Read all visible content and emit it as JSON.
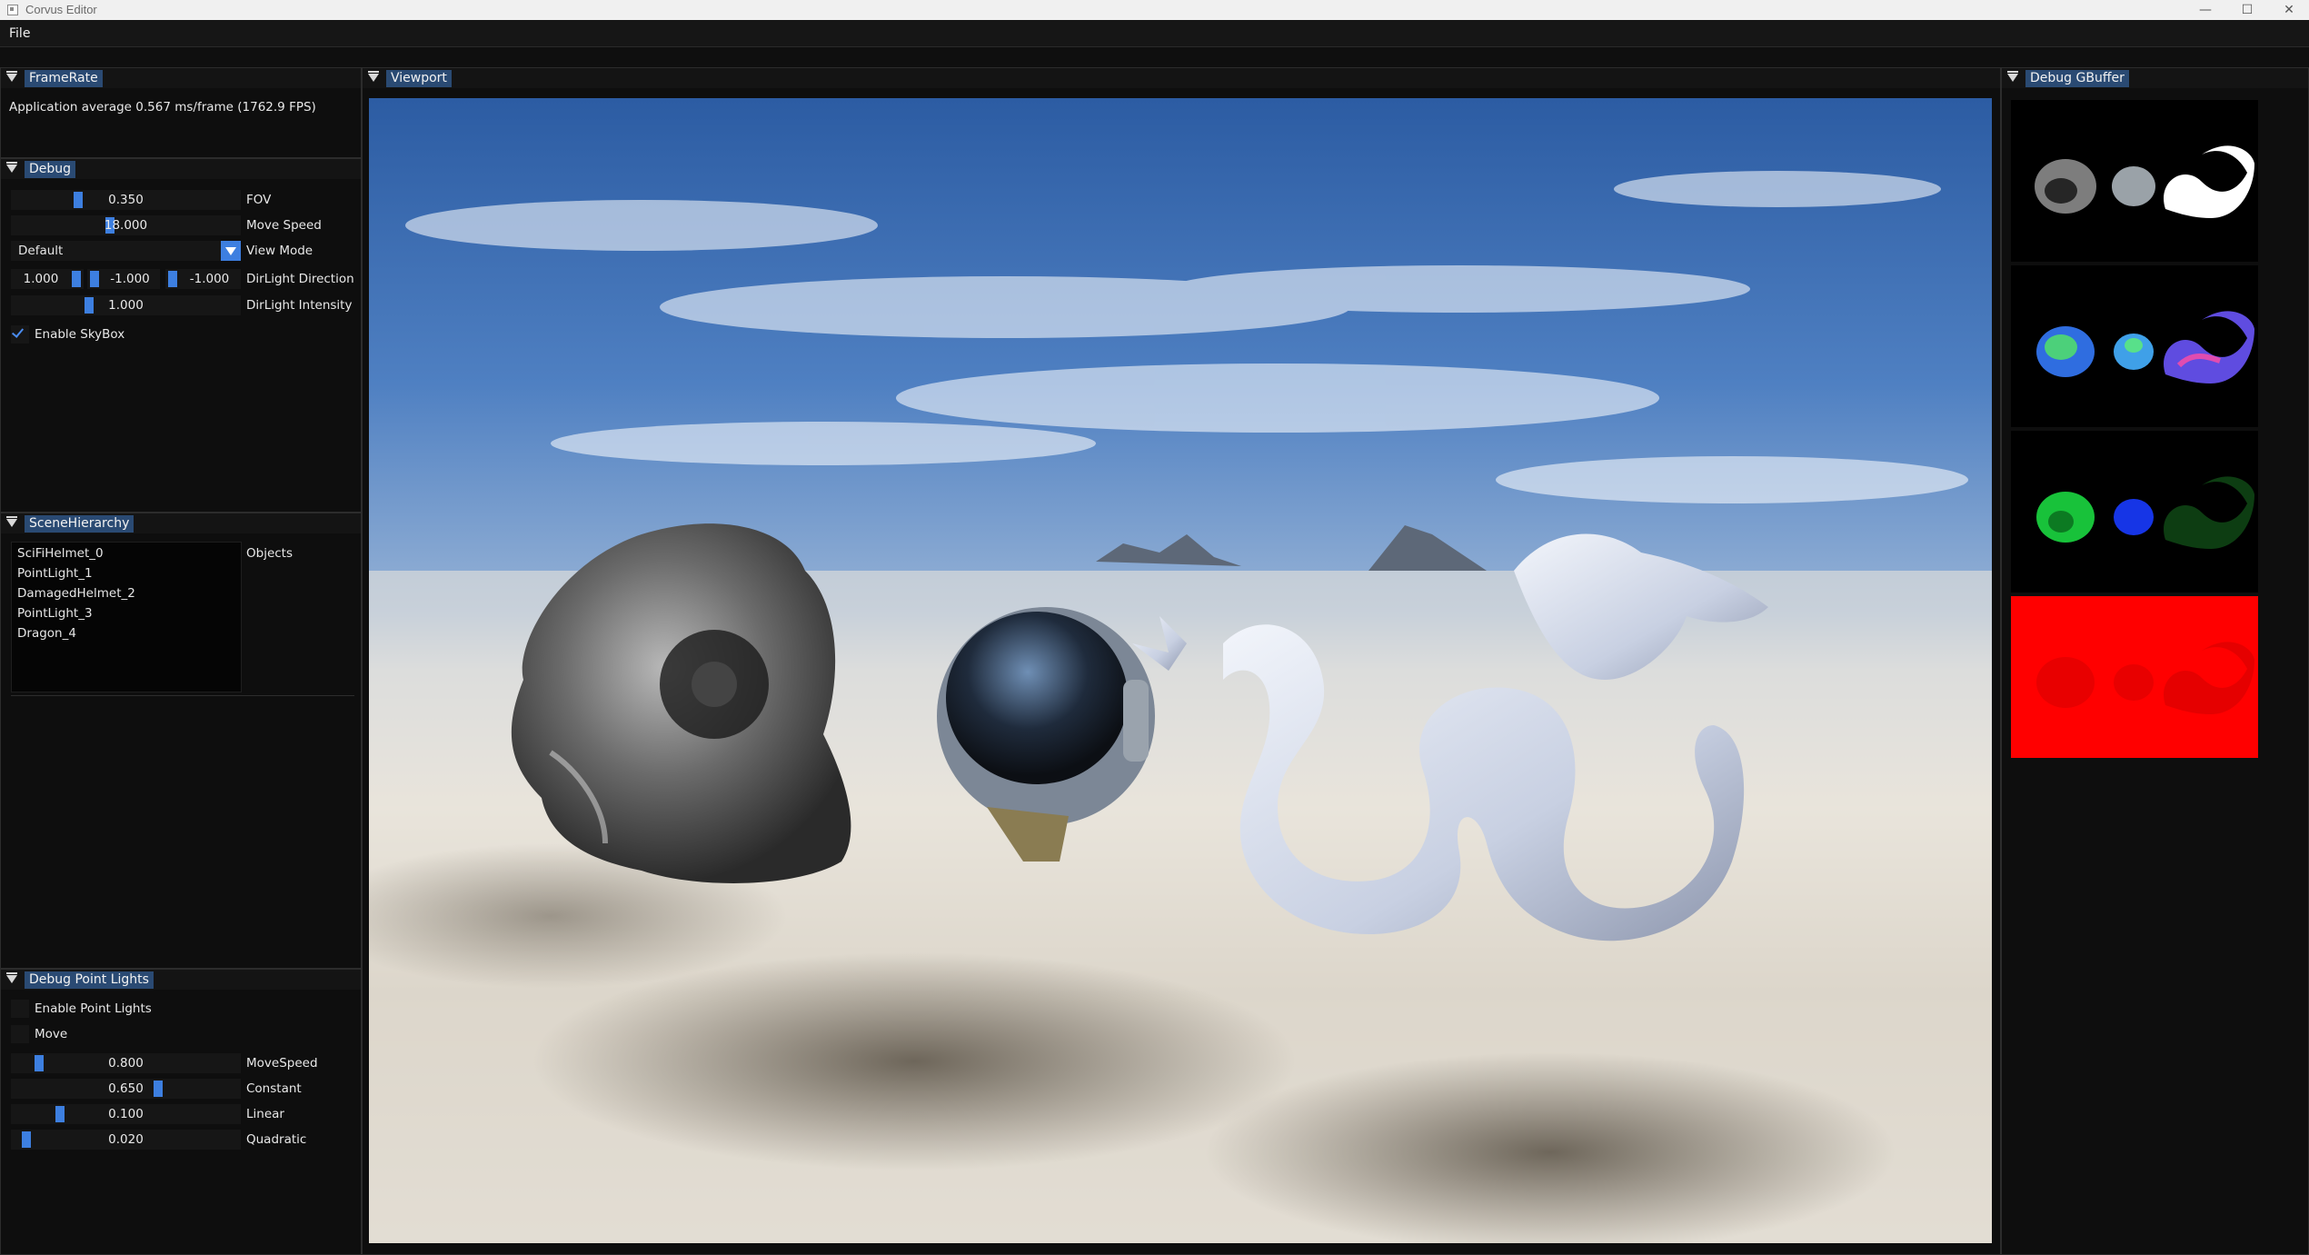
{
  "window": {
    "title": "Corvus Editor",
    "minimize_icon": "minimize-icon",
    "maximize_icon": "maximize-icon",
    "close_icon": "close-icon"
  },
  "menu": {
    "items": [
      "File"
    ]
  },
  "framerate": {
    "tab": "FrameRate",
    "text": "Application average 0.567 ms/frame (1762.9 FPS)"
  },
  "debug": {
    "tab": "Debug",
    "fov": {
      "label": "FOV",
      "value": "0.350"
    },
    "move_speed": {
      "label": "Move Speed",
      "value": "18.000"
    },
    "view_mode": {
      "label": "View Mode",
      "value": "Default"
    },
    "dir_light_direction": {
      "label": "DirLight Direction",
      "x": "1.000",
      "y": "-1.000",
      "z": "-1.000"
    },
    "dir_light_intensity": {
      "label": "DirLight Intensity",
      "value": "1.000"
    },
    "enable_skybox": {
      "label": "Enable SkyBox",
      "checked": true
    }
  },
  "scene_hierarchy": {
    "tab": "SceneHierarchy",
    "objects_label": "Objects",
    "objects": [
      "SciFiHelmet_0",
      "PointLight_1",
      "DamagedHelmet_2",
      "PointLight_3",
      "Dragon_4"
    ]
  },
  "debug_point_lights": {
    "tab": "Debug Point Lights",
    "enable": {
      "label": "Enable Point Lights",
      "checked": false
    },
    "move": {
      "label": "Move",
      "checked": false
    },
    "move_speed": {
      "label": "MoveSpeed",
      "value": "0.800"
    },
    "constant": {
      "label": "Constant",
      "value": "0.650"
    },
    "linear": {
      "label": "Linear",
      "value": "0.100"
    },
    "quadratic": {
      "label": "Quadratic",
      "value": "0.020"
    }
  },
  "viewport": {
    "tab": "Viewport"
  },
  "gbuffer": {
    "tab": "Debug GBuffer"
  },
  "colors": {
    "accent": "#3d7fe0",
    "tab_bg": "#2a4a73",
    "panel_bg": "#0e0e0e",
    "gbuffer_red": "#ff0000"
  }
}
